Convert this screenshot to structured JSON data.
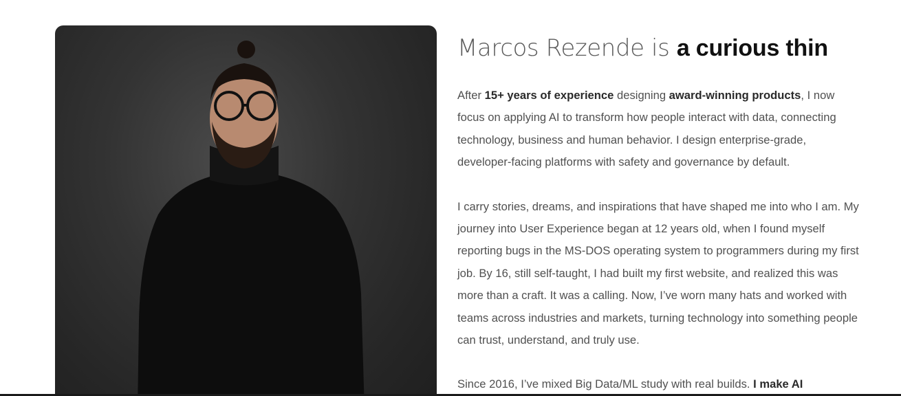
{
  "hero": {
    "headline_prefix": "Marcos Rezende is ",
    "headline_rotating": "a curious thin"
  },
  "about": {
    "p1": {
      "t1": "After ",
      "b1": "15+ years of experience",
      "t2": " designing ",
      "b2": "award-winning products",
      "t3": ", I now focus on applying AI to transform how people interact with data, connecting technology, business and human behavior. I design enterprise-grade, developer-facing platforms with safety and governance by default."
    },
    "p2": "I carry stories, dreams, and inspirations that have shaped me into who I am. My journey into User Experience began at 12 years old, when I found myself reporting bugs in the MS-DOS operating system to programmers during my first job. By 16, still self-taught, I had built my first website, and realized this was more than a craft. It was a calling. Now, I’ve worn many hats and worked with teams across industries and markets, turning technology into something people can trust, understand, and truly use.",
    "p3": {
      "t1": "Since 2016, I’ve mixed Big Data/ML study with real builds. ",
      "b1": "I make AI"
    }
  },
  "colors": {
    "background": "#ffffff",
    "photo_background": "#2b2b2b",
    "headline_strong": "#111111",
    "body_text": "#505050"
  }
}
